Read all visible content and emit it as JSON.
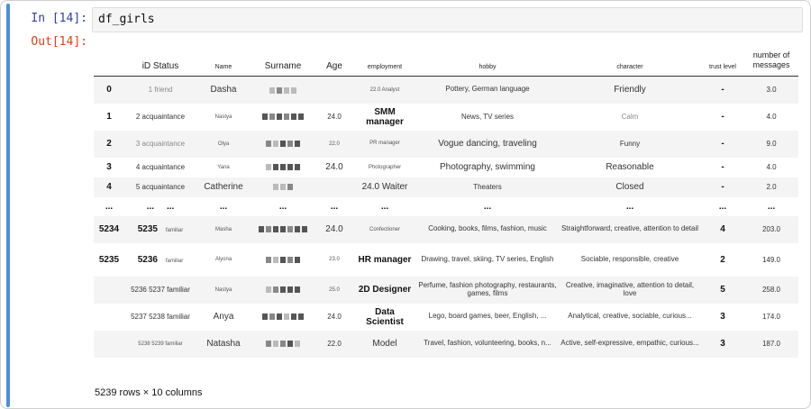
{
  "prompts": {
    "in": "In [14]:",
    "out": "Out[14]:"
  },
  "code": "df_girls",
  "columns": [
    "",
    "iD Status",
    "Name",
    "Surname",
    "Age",
    "employment",
    "hobby",
    "character",
    "trust level",
    "number of messages"
  ],
  "rows": [
    {
      "idx": "0",
      "id": "",
      "status": "1 friend",
      "name": "Dasha",
      "age": "",
      "employment": "22.0 Analyst",
      "hobby": "Pottery, German language",
      "character": "Friendly",
      "trust": "-",
      "messages": "3.0"
    },
    {
      "idx": "1",
      "id": "",
      "status": "2 acquaintance",
      "name": "Nastya",
      "age": "24.0",
      "employment": "SMM manager",
      "hobby": "News, TV series",
      "character": "Calm",
      "trust": "-",
      "messages": "4.0"
    },
    {
      "idx": "2",
      "id": "",
      "status": "3 acquaintance",
      "name": "Olya",
      "age": "22.0",
      "employment": "PR manager",
      "hobby": "Vogue dancing, traveling",
      "character": "Funny",
      "trust": "-",
      "messages": "9.0"
    },
    {
      "idx": "3",
      "id": "",
      "status": "4 acquaintance",
      "name": "Yana",
      "age": "24.0",
      "employment": "Photographer",
      "hobby": "Photography, swimming",
      "character": "Reasonable",
      "trust": "-",
      "messages": "4.0"
    },
    {
      "idx": "4",
      "id": "",
      "status": "5 acquaintance",
      "name": "Catherine",
      "age": "",
      "employment": "24.0 Waiter",
      "hobby": "Theaters",
      "character": "Closed",
      "trust": "-",
      "messages": "2.0"
    },
    {
      "idx": "...",
      "id": "...",
      "status": "...",
      "name": "...",
      "age": "...",
      "employment": "...",
      "hobby": "...",
      "character": "...",
      "trust": "...",
      "messages": "..."
    },
    {
      "idx": "5234",
      "id": "5235",
      "status": "familiar",
      "name": "Masha",
      "age": "24.0",
      "employment": "Confectioner",
      "hobby": "Cooking, books, films, fashion, music",
      "character": "Straightforward, creative, attention to detail",
      "trust": "4",
      "messages": "203.0"
    },
    {
      "idx": "5235",
      "id": "5236",
      "status": "familiar",
      "name": "Alyona",
      "age": "23.0",
      "employment": "HR manager",
      "hobby": "Drawing, travel, skiing, TV series, English",
      "character": "Sociable, responsible, creative",
      "trust": "2",
      "messages": "149.0"
    },
    {
      "idx": "",
      "id": "5236 5237",
      "status": "familiar",
      "name": "Nastya",
      "age": "25.0",
      "employment": "2D Designer",
      "hobby": "Perfume, fashion photography, restaurants, games, films",
      "character": "Creative, imaginative, attention to detail, love",
      "trust": "5",
      "messages": "258.0"
    },
    {
      "idx": "",
      "id": "5237 5238",
      "status": "familiar",
      "name": "Anya",
      "age": "24.0",
      "employment": "Data Scientist",
      "hobby": "Lego, board games, beer, English, ...",
      "character": "Analytical, creative, sociable, curious...",
      "trust": "3",
      "messages": "174.0"
    },
    {
      "idx": "",
      "id": "5238 5239",
      "status": "familiar",
      "name": "Natasha",
      "age": "22.0",
      "employment": "Model",
      "hobby": "Travel, fashion, volunteering, books, n...",
      "character": "Active, self-expressive, empathic, curious...",
      "trust": "3",
      "messages": "187.0"
    }
  ],
  "footer": "5239 rows × 10 columns",
  "colors": {
    "accent_bar": "#4a90d9",
    "prompt_in": "#303f9f",
    "prompt_out": "#d84315"
  },
  "icons": {
    "surname_cells": "pixelated-redaction"
  }
}
